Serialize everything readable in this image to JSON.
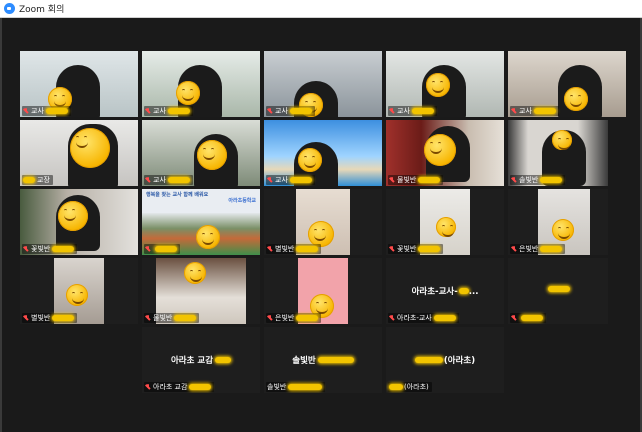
{
  "window": {
    "title": "Zoom 회의"
  },
  "colors": {
    "accent": "#2d8cff",
    "active_speaker": "#d8e24a",
    "muted_mic": "#ff4a4a",
    "name_blur": "#f2c400"
  },
  "tiles": [
    {
      "name": "교사",
      "muted": true
    },
    {
      "name": "교사",
      "muted": true
    },
    {
      "name": "교사",
      "muted": true
    },
    {
      "name": "교사",
      "muted": true
    },
    {
      "name": "교사",
      "muted": true
    },
    {
      "name": "교장",
      "muted": false
    },
    {
      "name": "교사",
      "muted": true
    },
    {
      "name": "교사",
      "muted": true
    },
    {
      "name": "물빛반",
      "muted": true
    },
    {
      "name": "솔빛반",
      "muted": true
    },
    {
      "name": "꽃빛반",
      "muted": true
    },
    {
      "name": "",
      "muted": true
    },
    {
      "name": "별빛반",
      "muted": true
    },
    {
      "name": "꽃빛반",
      "muted": true
    },
    {
      "name": "은빛반",
      "muted": true
    },
    {
      "name": "별빛반",
      "muted": true
    },
    {
      "name": "물빛반",
      "muted": true
    },
    {
      "name": "은빛반",
      "muted": true
    },
    {
      "name": "아라초-교사",
      "center": "아라초-교사-",
      "muted": true
    },
    {
      "name": "",
      "muted": true
    },
    {
      "name": "아라초 교감",
      "center": "아라초 교감",
      "muted": true
    },
    {
      "name": "솔빛반",
      "center": "솔빛반",
      "muted": false
    },
    {
      "name": "(아라초)",
      "center": "(아라초)",
      "muted": false
    }
  ],
  "banner": {
    "line1": "행복을 찾는 교사 함께 배워요",
    "school": "아라초등학교"
  }
}
